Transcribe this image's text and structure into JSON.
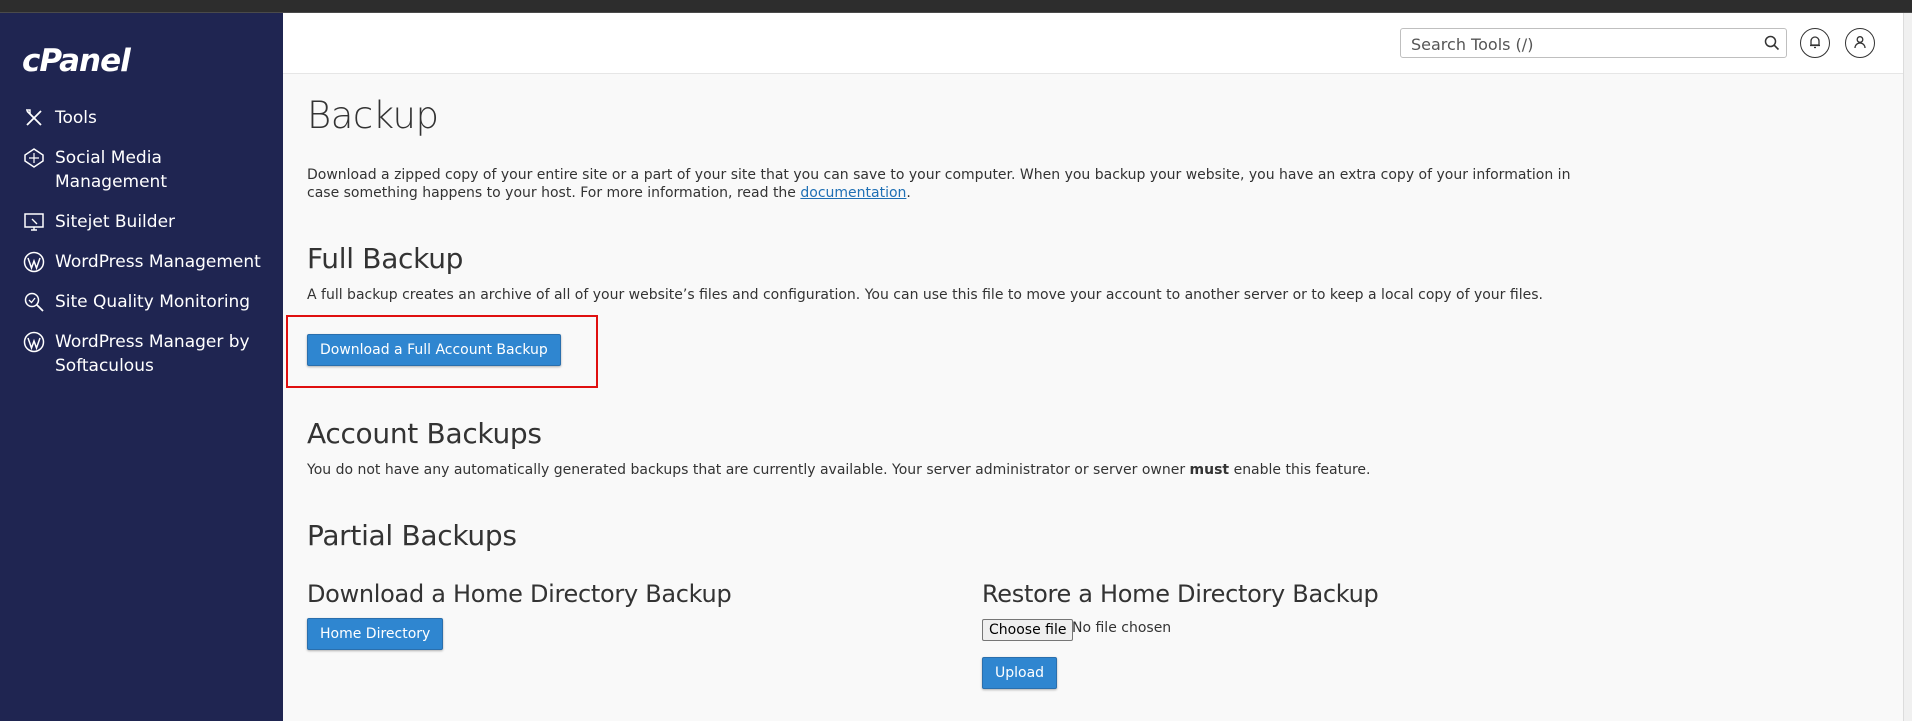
{
  "brand": {
    "logo": "cPanel"
  },
  "sidebar": {
    "items": [
      {
        "label": "Tools",
        "icon": "tools-icon"
      },
      {
        "label": "Social Media Management",
        "icon": "social-media-icon"
      },
      {
        "label": "Sitejet Builder",
        "icon": "sitejet-icon"
      },
      {
        "label": "WordPress Management",
        "icon": "wordpress-icon"
      },
      {
        "label": "Site Quality Monitoring",
        "icon": "site-quality-icon"
      },
      {
        "label": "WordPress Manager by Softaculous",
        "icon": "wordpress-icon"
      }
    ]
  },
  "header": {
    "search_placeholder": "Search Tools (/)"
  },
  "page": {
    "title": "Backup",
    "intro_text": "Download a zipped copy of your entire site or a part of your site that you can save to your computer. When you backup your website, you have an extra copy of your information in case something happens to your host. For more information, read the ",
    "intro_link": "documentation",
    "intro_end": "."
  },
  "full_backup": {
    "heading": "Full Backup",
    "description": "A full backup creates an archive of all of your website’s files and configuration. You can use this file to move your account to another server or to keep a local copy of your files.",
    "button": "Download a Full Account Backup"
  },
  "account_backups": {
    "heading": "Account Backups",
    "text_before": "You do not have any automatically generated backups that are currently available. Your server administrator or server owner ",
    "text_bold": "must",
    "text_after": " enable this feature."
  },
  "partial_backups": {
    "heading": "Partial Backups",
    "download_heading": "Download a Home Directory Backup",
    "download_button": "Home Directory",
    "restore_heading": "Restore a Home Directory Backup",
    "choose_file": "Choose file",
    "no_file": "No file chosen",
    "upload_button": "Upload"
  },
  "colors": {
    "sidebar_bg": "#1f2551",
    "button_blue": "#2f86d0",
    "highlight_red": "#e01010"
  }
}
